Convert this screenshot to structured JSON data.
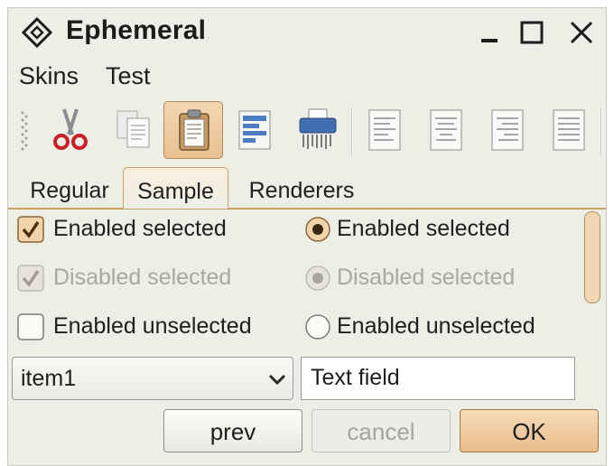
{
  "window": {
    "title": "Ephemeral"
  },
  "menubar": {
    "items": [
      "Skins",
      "Test"
    ]
  },
  "toolbar": {
    "buttons": [
      {
        "icon": "cut-icon"
      },
      {
        "icon": "copy-icon"
      },
      {
        "icon": "paste-icon",
        "active": true
      },
      {
        "icon": "document-icon"
      },
      {
        "icon": "shredder-icon"
      },
      {
        "icon": "align-left-icon"
      },
      {
        "icon": "align-center-icon"
      },
      {
        "icon": "align-right-icon"
      },
      {
        "icon": "align-justify-icon"
      }
    ]
  },
  "tabs": [
    {
      "label": "Regular",
      "selected": false
    },
    {
      "label": "Sample",
      "selected": true
    },
    {
      "label": "Renderers",
      "selected": false
    }
  ],
  "checkboxes": [
    {
      "label": "Enabled selected",
      "checked": true,
      "enabled": true
    },
    {
      "label": "Disabled selected",
      "checked": true,
      "enabled": false
    },
    {
      "label": "Enabled unselected",
      "checked": false,
      "enabled": true
    }
  ],
  "radios": [
    {
      "label": "Enabled selected",
      "checked": true,
      "enabled": true
    },
    {
      "label": "Disabled selected",
      "checked": true,
      "enabled": false
    },
    {
      "label": "Enabled unselected",
      "checked": false,
      "enabled": true
    }
  ],
  "combo": {
    "value": "item1"
  },
  "textfield": {
    "value": "Text field"
  },
  "buttons": {
    "prev": "prev",
    "cancel": "cancel",
    "ok": "OK"
  },
  "colors": {
    "accent": "#c9a063",
    "background": "#edefe6",
    "ok_fill": "#f0cfa4"
  }
}
